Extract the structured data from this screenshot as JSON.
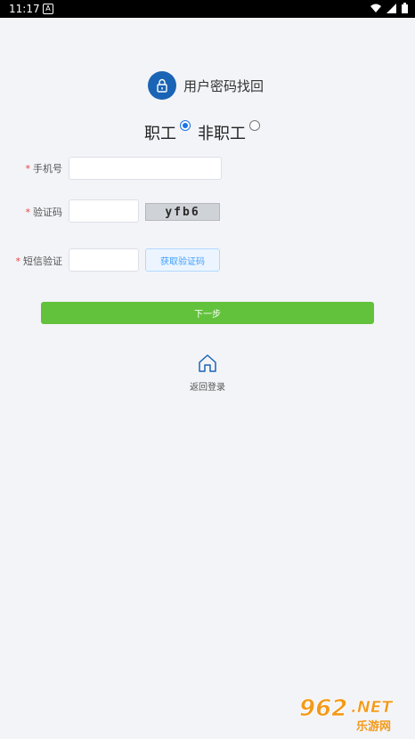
{
  "status_bar": {
    "time": "11:17",
    "notification_glyph": "A"
  },
  "header": {
    "title": "用户密码找回",
    "icon": "lock-icon",
    "icon_bg": "#1a64b5"
  },
  "user_type": {
    "options": [
      {
        "label": "职工",
        "selected": true
      },
      {
        "label": "非职工",
        "selected": false
      }
    ]
  },
  "form": {
    "phone": {
      "label": "手机号",
      "value": ""
    },
    "captcha": {
      "label": "验证码",
      "value": "",
      "image_text": "yfb6"
    },
    "sms": {
      "label": "短信验证",
      "value": "",
      "button_label": "获取验证码"
    },
    "required_mark": "*"
  },
  "next_button": {
    "label": "下一步",
    "color": "#63c23c"
  },
  "back_link": {
    "label": "返回登录",
    "icon": "home-icon"
  },
  "watermark": {
    "logo": "962.NET",
    "text": "乐游网"
  }
}
